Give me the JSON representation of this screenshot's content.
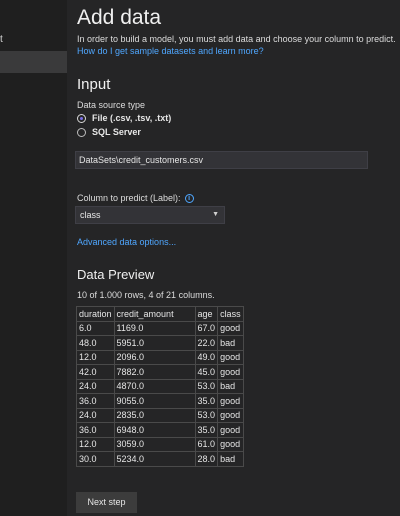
{
  "sidebar": {
    "items": [
      {
        "label": "t"
      },
      {
        "label": ""
      }
    ]
  },
  "main": {
    "title": "Add data",
    "intro_text": "In order to build a model, you must add data and choose your column to predict.",
    "intro_link": "How do I get sample datasets and learn more?",
    "input_heading": "Input",
    "data_source_label": "Data source type",
    "data_source_options": [
      {
        "label": "File (.csv, .tsv, .txt)",
        "selected": true
      },
      {
        "label": "SQL Server",
        "selected": false
      }
    ],
    "file_path": "DataSets\\credit_customers.csv",
    "column_label": "Column to predict (Label):",
    "column_selected": "class",
    "advanced_link": "Advanced data options...",
    "preview_heading": "Data Preview",
    "preview_info": "10 of 1.000 rows, 4 of 21 columns.",
    "table": {
      "headers": [
        "duration",
        "credit_amount",
        "age",
        "class"
      ],
      "rows": [
        [
          "6.0",
          "1169.0",
          "67.0",
          "good"
        ],
        [
          "48.0",
          "5951.0",
          "22.0",
          "bad"
        ],
        [
          "12.0",
          "2096.0",
          "49.0",
          "good"
        ],
        [
          "42.0",
          "7882.0",
          "45.0",
          "good"
        ],
        [
          "24.0",
          "4870.0",
          "53.0",
          "bad"
        ],
        [
          "36.0",
          "9055.0",
          "35.0",
          "good"
        ],
        [
          "24.0",
          "2835.0",
          "53.0",
          "good"
        ],
        [
          "36.0",
          "6948.0",
          "35.0",
          "good"
        ],
        [
          "12.0",
          "3059.0",
          "61.0",
          "good"
        ],
        [
          "30.0",
          "5234.0",
          "28.0",
          "bad"
        ]
      ]
    },
    "next_button": "Next step"
  },
  "colors": {
    "background": "#252526",
    "sidebar": "#1f1f1f",
    "link": "#4fa7ff",
    "radio_accent": "#7b6fe6"
  }
}
